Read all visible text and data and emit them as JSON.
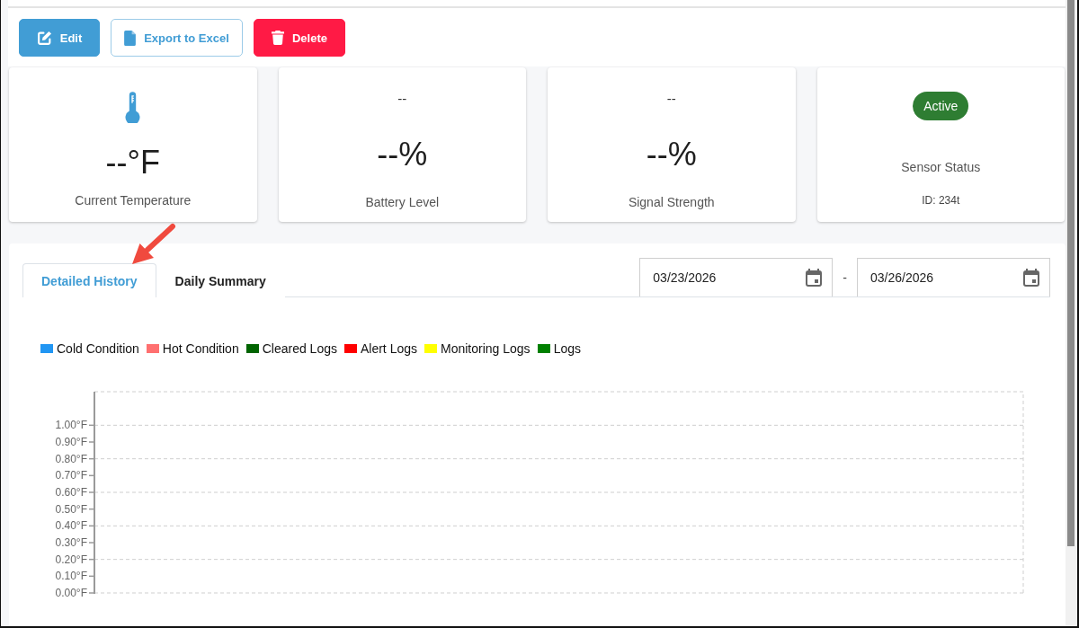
{
  "toolbar": {
    "buttons": [
      {
        "kind": "edit",
        "label": "Edit"
      },
      {
        "kind": "export",
        "label": "Export to Excel"
      },
      {
        "kind": "delete",
        "label": "Delete"
      }
    ]
  },
  "cards": [
    {
      "kind": "temperature",
      "value": "--°F",
      "label": "Current Temperature"
    },
    {
      "kind": "metric",
      "reading": "--",
      "value": "--%",
      "label": "Battery Level"
    },
    {
      "kind": "metric",
      "reading": "--",
      "value": "--%",
      "label": "Signal Strength"
    },
    {
      "kind": "status",
      "badge": "Active",
      "label": "Sensor Status",
      "sensor_id": "ID: 234t"
    }
  ],
  "history": {
    "tabs": [
      {
        "label": "Detailed History",
        "selected": true
      },
      {
        "label": "Daily Summary",
        "selected": false
      }
    ],
    "date_range": {
      "from": "03/23/2026",
      "separator": "-",
      "to": "03/26/2026"
    },
    "chart_data": {
      "type": "line",
      "grid": true,
      "ylim": [
        0,
        1.2
      ],
      "yticks": [
        {
          "value": 0,
          "label": "0.00°F"
        },
        {
          "value": 0.1,
          "label": "0.10°F"
        },
        {
          "value": 0.2,
          "label": "0.20°F"
        },
        {
          "value": 0.3,
          "label": "0.30°F"
        },
        {
          "value": 0.4,
          "label": "0.40°F"
        },
        {
          "value": 0.5,
          "label": "0.50°F"
        },
        {
          "value": 0.6,
          "label": "0.60°F"
        },
        {
          "value": 0.7,
          "label": "0.70°F"
        },
        {
          "value": 0.8,
          "label": "0.80°F"
        },
        {
          "value": 0.9,
          "label": "0.90°F"
        },
        {
          "value": 1.0,
          "label": "1.00°F"
        }
      ],
      "series": [
        {
          "name": "Cold Condition",
          "color": "#2196f3"
        },
        {
          "name": "Hot Condition",
          "color": "#ff7070"
        },
        {
          "name": "Cleared Logs",
          "color": "#006400"
        },
        {
          "name": "Alert Logs",
          "color": "#ff0000"
        },
        {
          "name": "Monitoring Logs",
          "color": "#ffff00"
        },
        {
          "name": "Logs",
          "color": "#008000"
        }
      ]
    }
  }
}
